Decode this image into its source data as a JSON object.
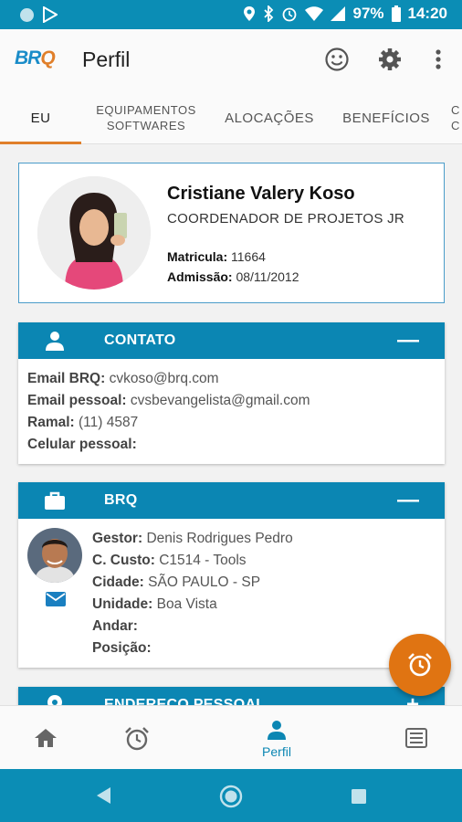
{
  "status_bar": {
    "battery": "97%",
    "time": "14:20"
  },
  "app": {
    "logo_b": "BR",
    "logo_q": "Q",
    "title": "Perfil"
  },
  "tabs": [
    {
      "label": "EU",
      "active": true
    },
    {
      "label_line1": "EQUIPAMENTOS",
      "label_line2": "SOFTWARES"
    },
    {
      "label": "ALOCAÇÕES"
    },
    {
      "label": "BENEFÍCIOS"
    },
    {
      "label_line1": "C",
      "label_line2": "C"
    }
  ],
  "profile": {
    "name": "Cristiane Valery Koso",
    "role": "COORDENADOR DE PROJETOS JR",
    "matricula_label": "Matricula:",
    "matricula": "11664",
    "admissao_label": "Admissão:",
    "admissao": "08/11/2012"
  },
  "contato": {
    "title": "CONTATO",
    "toggle": "—",
    "rows": [
      {
        "label": "Email BRQ:",
        "value": "cvkoso@brq.com"
      },
      {
        "label": "Email pessoal:",
        "value": "cvsbevangelista@gmail.com"
      },
      {
        "label": "Ramal:",
        "value": "(11) 4587"
      },
      {
        "label": "Celular pessoal:",
        "value": ""
      }
    ]
  },
  "brq": {
    "title": "BRQ",
    "toggle": "—",
    "rows": [
      {
        "label": "Gestor:",
        "value": "Denis Rodrigues Pedro"
      },
      {
        "label": "C. Custo:",
        "value": "C1514 - Tools"
      },
      {
        "label": "Cidade:",
        "value": "SÃO PAULO - SP"
      },
      {
        "label": "Unidade:",
        "value": "Boa Vista"
      },
      {
        "label": "Andar:",
        "value": ""
      },
      {
        "label": "Posição:",
        "value": ""
      }
    ]
  },
  "endereco": {
    "title": "ENDEREÇO PESSOAL",
    "toggle": "+"
  },
  "bottom_nav": {
    "profile_label": "Perfil"
  },
  "colors": {
    "primary": "#0b86b3",
    "accent": "#e07412",
    "tab_indicator": "#e07f2a"
  }
}
